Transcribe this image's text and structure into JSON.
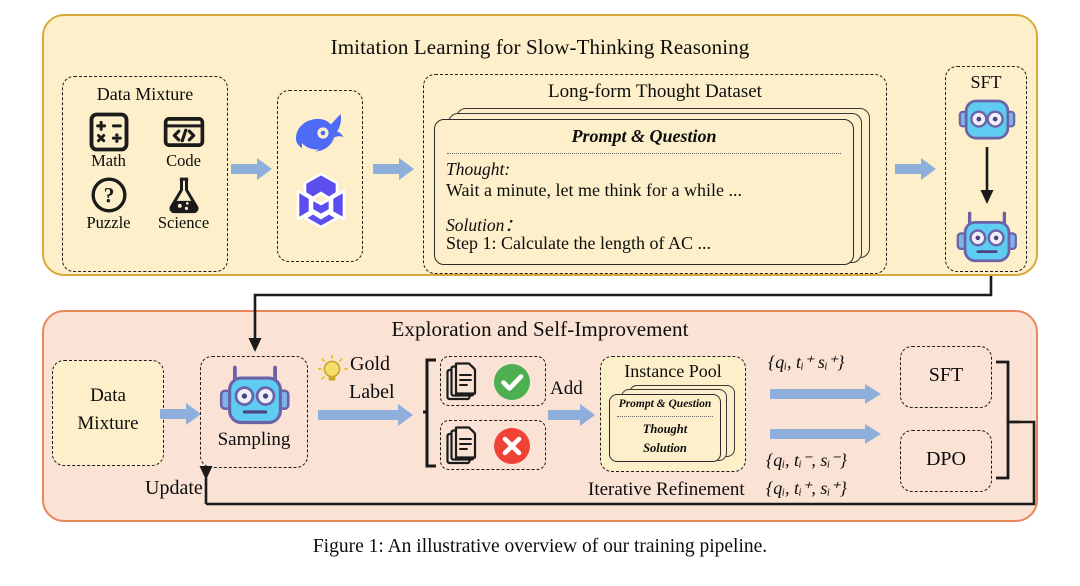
{
  "figure": {
    "caption": "Figure 1: An illustrative overview of our training pipeline."
  },
  "colors": {
    "top_panel_fill": "#FCEFC9",
    "top_panel_border": "#D8A93A",
    "bottom_panel_fill": "#FAE3D5",
    "bottom_panel_border": "#E8875A",
    "blue_arrow": "#8EAEDC",
    "robot_face": "#5FCCF2",
    "robot_outline": "#6B62A8",
    "deepseek_blue": "#4D6BF5",
    "qwq_purple": "#5B4DEE",
    "check_green": "#4CAF50",
    "cross_red": "#EF4136",
    "card_fill": "#FCEFC9",
    "wire_black": "#1b1b1b"
  },
  "top_panel": {
    "title": "Imitation Learning for Slow-Thinking Reasoning",
    "data_mixture": {
      "label": "Data Mixture",
      "items": [
        {
          "icon": "math-icon",
          "label": "Math"
        },
        {
          "icon": "code-icon",
          "label": "Code"
        },
        {
          "icon": "puzzle-icon",
          "label": "Puzzle"
        },
        {
          "icon": "science-icon",
          "label": "Science"
        }
      ]
    },
    "models": [
      {
        "icon": "deepseek-whale-logo",
        "label": "DeepSeek"
      },
      {
        "icon": "qwq-logo",
        "label": "QwQ"
      }
    ],
    "dataset": {
      "title": "Long-form Thought Dataset",
      "card": {
        "header": "Prompt & Question",
        "thought_label": "Thought:",
        "thought_text": "Wait a minute, let me think for a while ...",
        "solution_label": "Solution：",
        "solution_text": "Step 1: Calculate the length of AC ..."
      }
    },
    "sft": {
      "label": "SFT",
      "robot_before": "robot-base-icon",
      "robot_after": "robot-tuned-icon"
    }
  },
  "bottom_panel": {
    "title": "Exploration and Self-Improvement",
    "data_mixture": {
      "line1": "Data",
      "line2": "Mixture"
    },
    "sampling": {
      "label": "Sampling",
      "icon": "robot-tuned-icon"
    },
    "gold_label": {
      "icon": "lightbulb-icon",
      "line1": "Gold",
      "line2": "Label"
    },
    "outcomes": [
      {
        "icon": "documents-check-icon",
        "status": "correct"
      },
      {
        "icon": "documents-cross-icon",
        "status": "incorrect"
      }
    ],
    "add_label": "Add",
    "instance_pool": {
      "title": "Instance Pool",
      "card_lines": [
        "Prompt & Question",
        "Thought",
        "Solution"
      ]
    },
    "iterative_refinement_label": "Iterative Refinement",
    "update_label": "Update",
    "tuples": {
      "sft_positive": "{qᵢ, tᵢ⁺ sᵢ⁺}",
      "dpo_negative": "{qᵢ, tᵢ⁻, sᵢ⁻}",
      "dpo_positive": "{qᵢ, tᵢ⁺, sᵢ⁺}"
    },
    "objectives": [
      {
        "label": "SFT"
      },
      {
        "label": "DPO"
      }
    ]
  }
}
